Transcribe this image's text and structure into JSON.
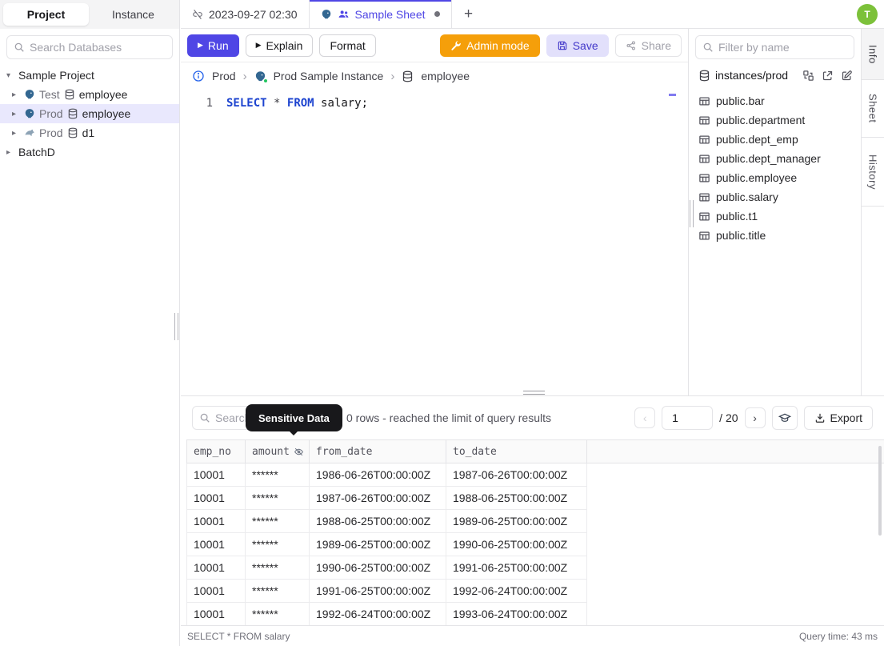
{
  "colors": {
    "accent_indigo": "#4f46e5",
    "admin_orange": "#f59f0a",
    "avatar_green": "#7cc13a",
    "postgres_blue": "#336791",
    "mysql_gray": "#8da3b5",
    "keyword_blue": "#1c43cf",
    "tooltip_bg": "#18181b",
    "status_green": "#22c55e"
  },
  "left_sidebar": {
    "tabs": [
      {
        "label": "Project",
        "active": true
      },
      {
        "label": "Instance",
        "active": false
      }
    ],
    "search_placeholder": "Search Databases",
    "tree": [
      {
        "label": "Sample Project",
        "type": "project",
        "expanded": true
      },
      {
        "env": "Test",
        "db": "employee",
        "engine": "postgresql"
      },
      {
        "env": "Prod",
        "db": "employee",
        "engine": "postgresql",
        "selected": true
      },
      {
        "env": "Prod",
        "db": "d1",
        "engine": "mysql"
      },
      {
        "label": "BatchD",
        "type": "project",
        "expanded": false
      }
    ]
  },
  "tab_bar": {
    "sheet_tabs": [
      {
        "label": "2023-09-27 02:30",
        "icon": "unlink-icon",
        "active": false
      },
      {
        "label": "Sample Sheet",
        "icons": [
          "postgresql-icon",
          "people-icon"
        ],
        "active": true,
        "dirty": true
      }
    ],
    "add_label": "+",
    "avatar_initial": "T"
  },
  "toolbar": {
    "run_label": "Run",
    "explain_label": "Explain",
    "format_label": "Format",
    "admin_mode_label": "Admin mode",
    "save_label": "Save",
    "share_label": "Share"
  },
  "breadcrumb": {
    "environment": "Prod",
    "instance": "Prod Sample Instance",
    "database": "employee"
  },
  "editor": {
    "line_number": "1",
    "code": {
      "kw1": "SELECT",
      "star": "*",
      "kw2": "FROM",
      "rest": " salary;"
    }
  },
  "right_sidebar": {
    "filter_placeholder": "Filter by name",
    "connection": "instances/prod",
    "tables": [
      "public.bar",
      "public.department",
      "public.dept_emp",
      "public.dept_manager",
      "public.employee",
      "public.salary",
      "public.t1",
      "public.title"
    ],
    "vertical_tabs": [
      {
        "label": "Info",
        "active": true
      },
      {
        "label": "Sheet",
        "active": false
      },
      {
        "label": "History",
        "active": false
      }
    ]
  },
  "results": {
    "search_placeholder": "Search",
    "tooltip_text": "Sensitive Data",
    "rows_info": "0 rows  -  reached the limit of query results",
    "pagination": {
      "prev": "‹",
      "page": "1",
      "total": "/ 20",
      "next": "›"
    },
    "export_label": "Export",
    "table": {
      "columns": [
        "emp_no",
        "amount",
        "from_date",
        "to_date"
      ],
      "masked_column": "amount",
      "rows": [
        [
          "10001",
          "******",
          "1986-06-26T00:00:00Z",
          "1987-06-26T00:00:00Z"
        ],
        [
          "10001",
          "******",
          "1987-06-26T00:00:00Z",
          "1988-06-25T00:00:00Z"
        ],
        [
          "10001",
          "******",
          "1988-06-25T00:00:00Z",
          "1989-06-25T00:00:00Z"
        ],
        [
          "10001",
          "******",
          "1989-06-25T00:00:00Z",
          "1990-06-25T00:00:00Z"
        ],
        [
          "10001",
          "******",
          "1990-06-25T00:00:00Z",
          "1991-06-25T00:00:00Z"
        ],
        [
          "10001",
          "******",
          "1991-06-25T00:00:00Z",
          "1992-06-24T00:00:00Z"
        ],
        [
          "10001",
          "******",
          "1992-06-24T00:00:00Z",
          "1993-06-24T00:00:00Z"
        ]
      ]
    },
    "status_left": "SELECT * FROM salary",
    "status_right": "Query time: 43 ms"
  }
}
